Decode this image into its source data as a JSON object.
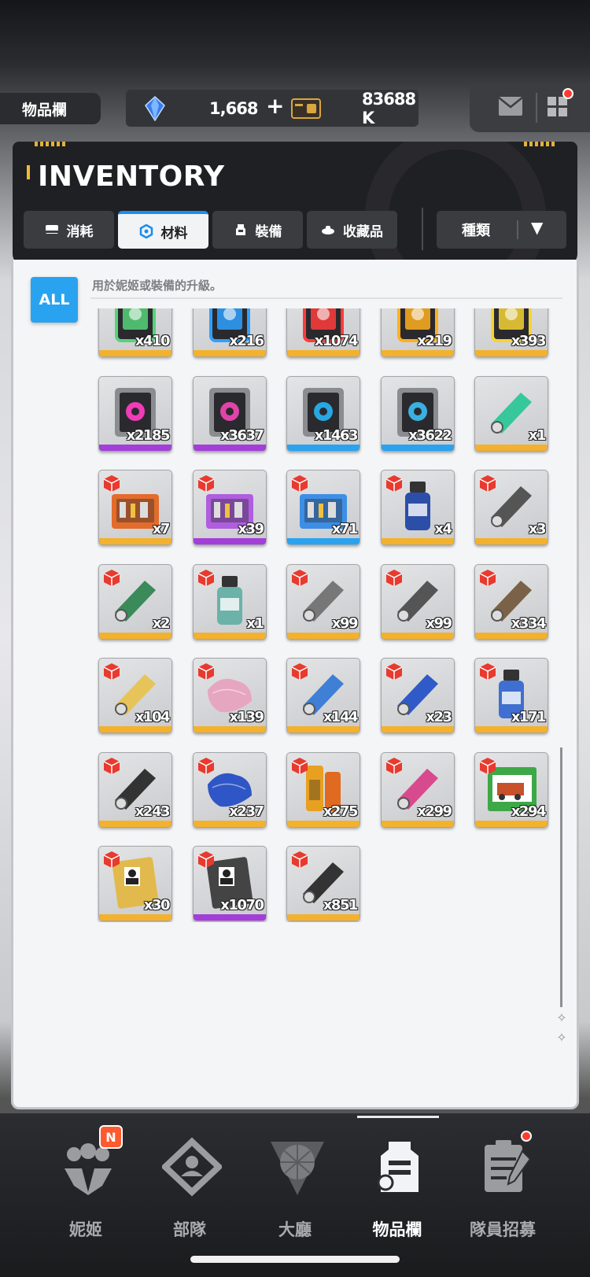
{
  "header": {
    "page_title": "物品欄",
    "gems": "1,668",
    "gems_plus": "+",
    "credits": "83688 K"
  },
  "inventory": {
    "title": "INVENTORY",
    "tabs": [
      {
        "label": "消耗",
        "active": false
      },
      {
        "label": "材料",
        "active": true
      },
      {
        "label": "裝備",
        "active": false
      },
      {
        "label": "收藏品",
        "active": false
      }
    ],
    "sort_label": "種類",
    "filter_all": "ALL",
    "description": "用於妮姬或裝備的升級。"
  },
  "items": [
    {
      "name": "core-green",
      "rarity": "gold",
      "qty": "x410",
      "color": "#56d27a"
    },
    {
      "name": "core-blue",
      "rarity": "gold",
      "qty": "x216",
      "color": "#2fa0ff"
    },
    {
      "name": "core-red",
      "rarity": "gold",
      "qty": "x1074",
      "color": "#ff3c3c"
    },
    {
      "name": "core-orange",
      "rarity": "gold",
      "qty": "x219",
      "color": "#ffb01f"
    },
    {
      "name": "core-yellow",
      "rarity": "gold",
      "qty": "x393",
      "color": "#f6d335"
    },
    {
      "name": "module-pink-1",
      "rarity": "purple",
      "qty": "x2185",
      "color": "#f03cb6"
    },
    {
      "name": "module-pink-2",
      "rarity": "purple",
      "qty": "x3637",
      "color": "#e044a8"
    },
    {
      "name": "module-cyan-1",
      "rarity": "blue",
      "qty": "x1463",
      "color": "#27a8e3"
    },
    {
      "name": "module-cyan-2",
      "rarity": "blue",
      "qty": "x3622",
      "color": "#3bb0e0"
    },
    {
      "name": "green-device",
      "rarity": "gold",
      "qty": "x1",
      "color": "#36c89a"
    },
    {
      "name": "toolbox-orange",
      "rarity": "gold",
      "qty": "x7",
      "color": "#e36b2b"
    },
    {
      "name": "toolbox-purple",
      "rarity": "purple",
      "qty": "x39",
      "color": "#b05de0"
    },
    {
      "name": "toolbox-blue",
      "rarity": "blue",
      "qty": "x71",
      "color": "#3d8ee6"
    },
    {
      "name": "glue-bottle",
      "rarity": "gold",
      "qty": "x4",
      "color": "#2b4ea8"
    },
    {
      "name": "file-tool",
      "rarity": "gold",
      "qty": "x3",
      "color": "#555"
    },
    {
      "name": "green-cord",
      "rarity": "gold",
      "qty": "x2",
      "color": "#3a8a5a"
    },
    {
      "name": "chemical-jar",
      "rarity": "gold",
      "qty": "x1",
      "color": "#6bb2a8"
    },
    {
      "name": "brush-kit",
      "rarity": "gold",
      "qty": "x99",
      "color": "#777"
    },
    {
      "name": "glasses-case",
      "rarity": "gold",
      "qty": "x99",
      "color": "#555"
    },
    {
      "name": "sandpaper",
      "rarity": "gold",
      "qty": "x334",
      "color": "#7a6248"
    },
    {
      "name": "sticky-notes",
      "rarity": "gold",
      "qty": "x104",
      "color": "#e6c45a"
    },
    {
      "name": "pink-cloth",
      "rarity": "gold",
      "qty": "x139",
      "color": "#e7a6c0"
    },
    {
      "name": "feather-duster",
      "rarity": "gold",
      "qty": "x144",
      "color": "#3f7fd6"
    },
    {
      "name": "syringe",
      "rarity": "gold",
      "qty": "x23",
      "color": "#2f5ac8"
    },
    {
      "name": "spray-bottle",
      "rarity": "gold",
      "qty": "x171",
      "color": "#3f6fd0"
    },
    {
      "name": "power-adapter",
      "rarity": "gold",
      "qty": "x243",
      "color": "#333"
    },
    {
      "name": "blue-cloth",
      "rarity": "gold",
      "qty": "x237",
      "color": "#2f56c6"
    },
    {
      "name": "battery",
      "rarity": "gold",
      "qty": "x275",
      "color": "#e8a020"
    },
    {
      "name": "polisher",
      "rarity": "gold",
      "qty": "x299",
      "color": "#d84a8e"
    },
    {
      "name": "toy-train-box",
      "rarity": "gold",
      "qty": "x294",
      "color": "#3ea848"
    },
    {
      "name": "id-card-gold",
      "rarity": "gold",
      "qty": "x30",
      "color": "#e2b94c"
    },
    {
      "name": "id-card-black",
      "rarity": "purple",
      "qty": "x1070",
      "color": "#444"
    },
    {
      "name": "stapler-tool",
      "rarity": "gold",
      "qty": "x851",
      "color": "#333"
    }
  ],
  "nav": [
    {
      "label": "妮姬",
      "icon": "nikke-icon",
      "badge": "N"
    },
    {
      "label": "部隊",
      "icon": "squad-icon"
    },
    {
      "label": "大廳",
      "icon": "lobby-icon"
    },
    {
      "label": "物品欄",
      "icon": "inventory-icon",
      "active": true
    },
    {
      "label": "隊員招募",
      "icon": "recruit-icon"
    }
  ]
}
